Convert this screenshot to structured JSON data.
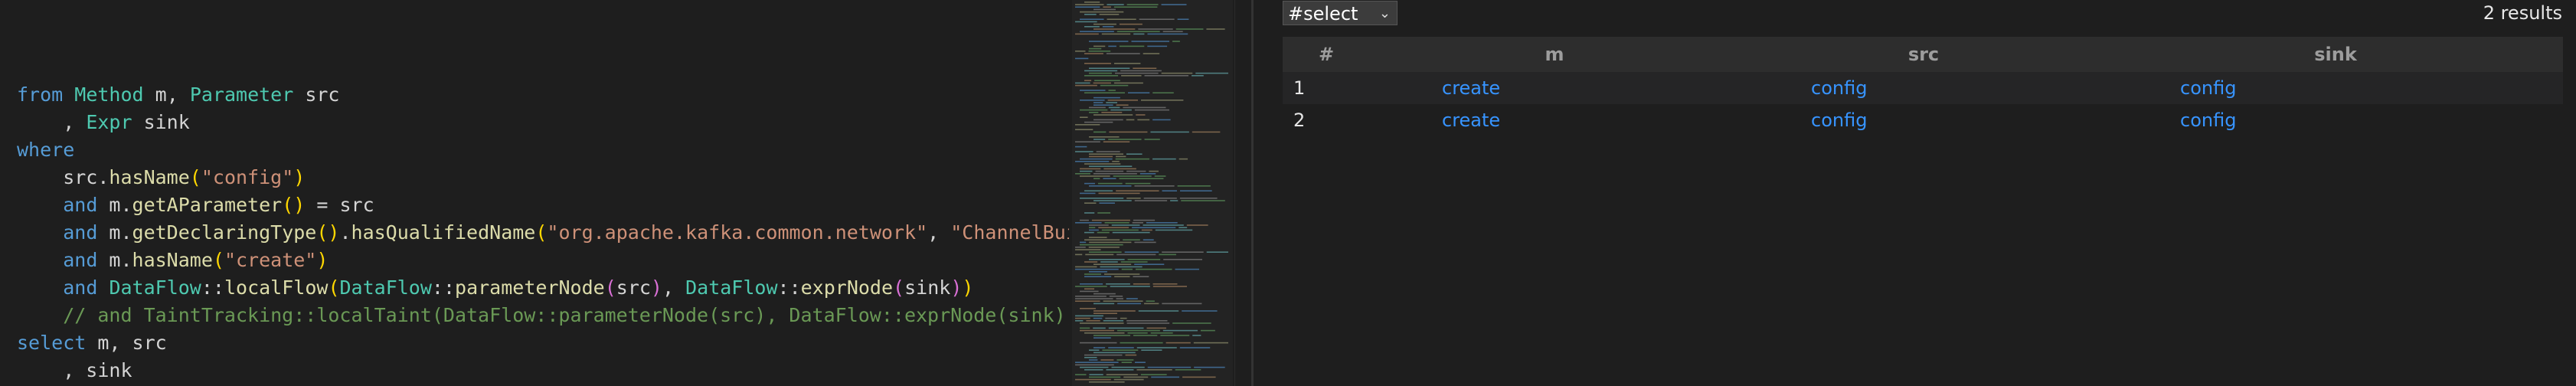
{
  "editor": {
    "lines": [
      [
        [
          "kw",
          "from"
        ],
        [
          "pn",
          " "
        ],
        [
          "ty",
          "Method"
        ],
        [
          "pn",
          " m, "
        ],
        [
          "ty",
          "Parameter"
        ],
        [
          "pn",
          " src"
        ]
      ],
      [
        [
          "pn",
          "    , "
        ],
        [
          "ty",
          "Expr"
        ],
        [
          "pn",
          " sink"
        ]
      ],
      [
        [
          "kw",
          "where"
        ]
      ],
      [
        [
          "pn",
          "    src."
        ],
        [
          "fn",
          "hasName"
        ],
        [
          "pa",
          "("
        ],
        [
          "str",
          "\"config\""
        ],
        [
          "pa",
          ")"
        ]
      ],
      [
        [
          "pn",
          "    "
        ],
        [
          "kw",
          "and"
        ],
        [
          "pn",
          " m."
        ],
        [
          "fn",
          "getAParameter"
        ],
        [
          "pa",
          "()"
        ],
        [
          "pn",
          " = src"
        ]
      ],
      [
        [
          "pn",
          "    "
        ],
        [
          "kw",
          "and"
        ],
        [
          "pn",
          " m."
        ],
        [
          "fn",
          "getDeclaringType"
        ],
        [
          "pa",
          "()"
        ],
        [
          "pn",
          "."
        ],
        [
          "fn",
          "hasQualifiedName"
        ],
        [
          "pa",
          "("
        ],
        [
          "str",
          "\"org.apache.kafka.common.network\""
        ],
        [
          "pn",
          ", "
        ],
        [
          "str",
          "\"ChannelBuilde"
        ]
      ],
      [
        [
          "pn",
          "    "
        ],
        [
          "kw",
          "and"
        ],
        [
          "pn",
          " m."
        ],
        [
          "fn",
          "hasName"
        ],
        [
          "pa",
          "("
        ],
        [
          "str",
          "\"create\""
        ],
        [
          "pa",
          ")"
        ]
      ],
      [
        [
          "pn",
          "    "
        ],
        [
          "kw",
          "and"
        ],
        [
          "pn",
          " "
        ],
        [
          "ty",
          "DataFlow"
        ],
        [
          "pn",
          "::"
        ],
        [
          "fn",
          "localFlow"
        ],
        [
          "pa",
          "("
        ],
        [
          "ty",
          "DataFlow"
        ],
        [
          "pn",
          "::"
        ],
        [
          "fn",
          "parameterNode"
        ],
        [
          "pb",
          "("
        ],
        [
          "pn",
          "src"
        ],
        [
          "pb",
          ")"
        ],
        [
          "pn",
          ", "
        ],
        [
          "ty",
          "DataFlow"
        ],
        [
          "pn",
          "::"
        ],
        [
          "fn",
          "exprNode"
        ],
        [
          "pb",
          "("
        ],
        [
          "pn",
          "sink"
        ],
        [
          "pb",
          ")"
        ],
        [
          "pa",
          ")"
        ]
      ],
      [
        [
          "cm",
          "    // and TaintTracking::localTaint(DataFlow::parameterNode(src), DataFlow::exprNode(sink))"
        ]
      ],
      [
        [
          "kw",
          "select"
        ],
        [
          "pn",
          " m, src"
        ]
      ],
      [
        [
          "pn",
          "    , sink"
        ]
      ]
    ]
  },
  "results": {
    "select_value": "#select",
    "count_text": "2 results",
    "columns": [
      "#",
      "m",
      "src",
      "sink"
    ],
    "rows": [
      {
        "idx": "1",
        "m": "create",
        "src": "config",
        "sink": "config"
      },
      {
        "idx": "2",
        "m": "create",
        "src": "config",
        "sink": "config"
      }
    ]
  }
}
